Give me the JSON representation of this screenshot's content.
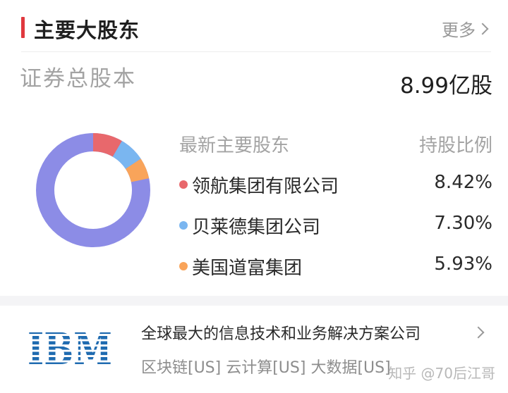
{
  "section": {
    "title": "主要大股东",
    "more_label": "更多"
  },
  "capital": {
    "label": "证券总股本",
    "value": "8.99亿股"
  },
  "holders_header": {
    "left": "最新主要股东",
    "right": "持股比例"
  },
  "holders": [
    {
      "name": "领航集团有限公司",
      "percent": "8.42%",
      "share": 8.42,
      "color": "#e8686c"
    },
    {
      "name": "贝莱德集团公司",
      "percent": "7.30%",
      "share": 7.3,
      "color": "#7ab6f0"
    },
    {
      "name": "美国道富集团",
      "percent": "5.93%",
      "share": 5.93,
      "color": "#f9a45a"
    }
  ],
  "others_color": "#8c8ce6",
  "company": {
    "logo_text": "IBM",
    "logo_color": "#1f6bb0",
    "title": "全球最大的信息技术和业务解决方案公司",
    "tags": "区块链[US] 云计算[US] 大数据[US]"
  },
  "watermark": "知乎 @70后江哥"
}
